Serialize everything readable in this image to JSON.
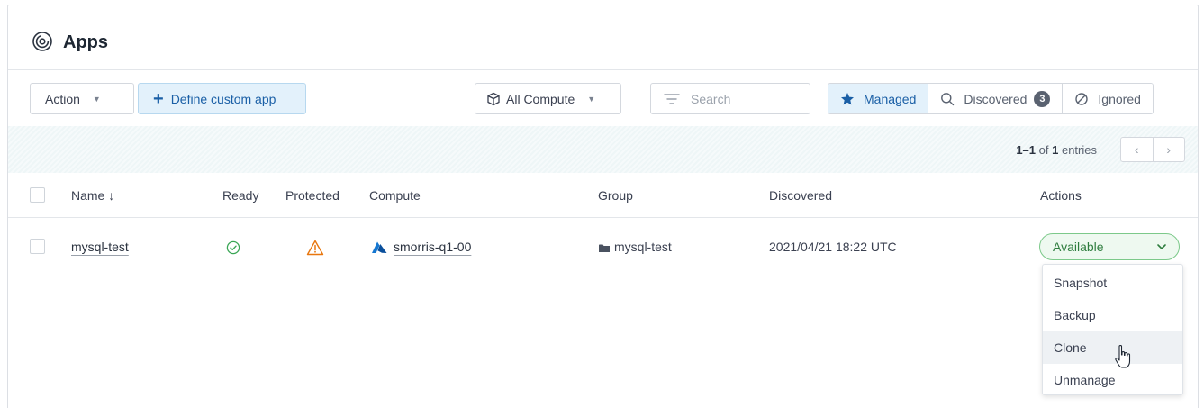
{
  "page": {
    "title": "Apps",
    "logo_icon": "apps-swirl-icon"
  },
  "toolbar": {
    "action_label": "Action",
    "define_label": "Define custom app",
    "compute_label": "All Compute",
    "search_placeholder": "Search",
    "filters": [
      {
        "label": "Managed",
        "icon": "star-icon",
        "active": true
      },
      {
        "label": "Discovered",
        "icon": "search-icon",
        "count": "3",
        "active": false
      },
      {
        "label": "Ignored",
        "icon": "ban-icon",
        "active": false
      }
    ]
  },
  "pagination": {
    "range": "1–1",
    "of": "of",
    "total": "1",
    "suffix": "entries"
  },
  "table": {
    "columns": [
      "Name ↓",
      "Ready",
      "Protected",
      "Compute",
      "Group",
      "Discovered",
      "Actions"
    ],
    "rows": [
      {
        "name": "mysql-test",
        "ready": "ready-check-icon",
        "protected": "warning-icon",
        "compute": "smorris-q1-00",
        "group": "mysql-test",
        "discovered": "2021/04/21 18:22 UTC",
        "status": "Available"
      }
    ]
  },
  "actions_menu": {
    "items": [
      "Snapshot",
      "Backup",
      "Clone",
      "Unmanage"
    ],
    "hovered": "Clone"
  },
  "colors": {
    "accent": "#1a5fa6",
    "available": "#2f7d3f",
    "warning": "#e8770f",
    "ready": "#3aa655"
  }
}
